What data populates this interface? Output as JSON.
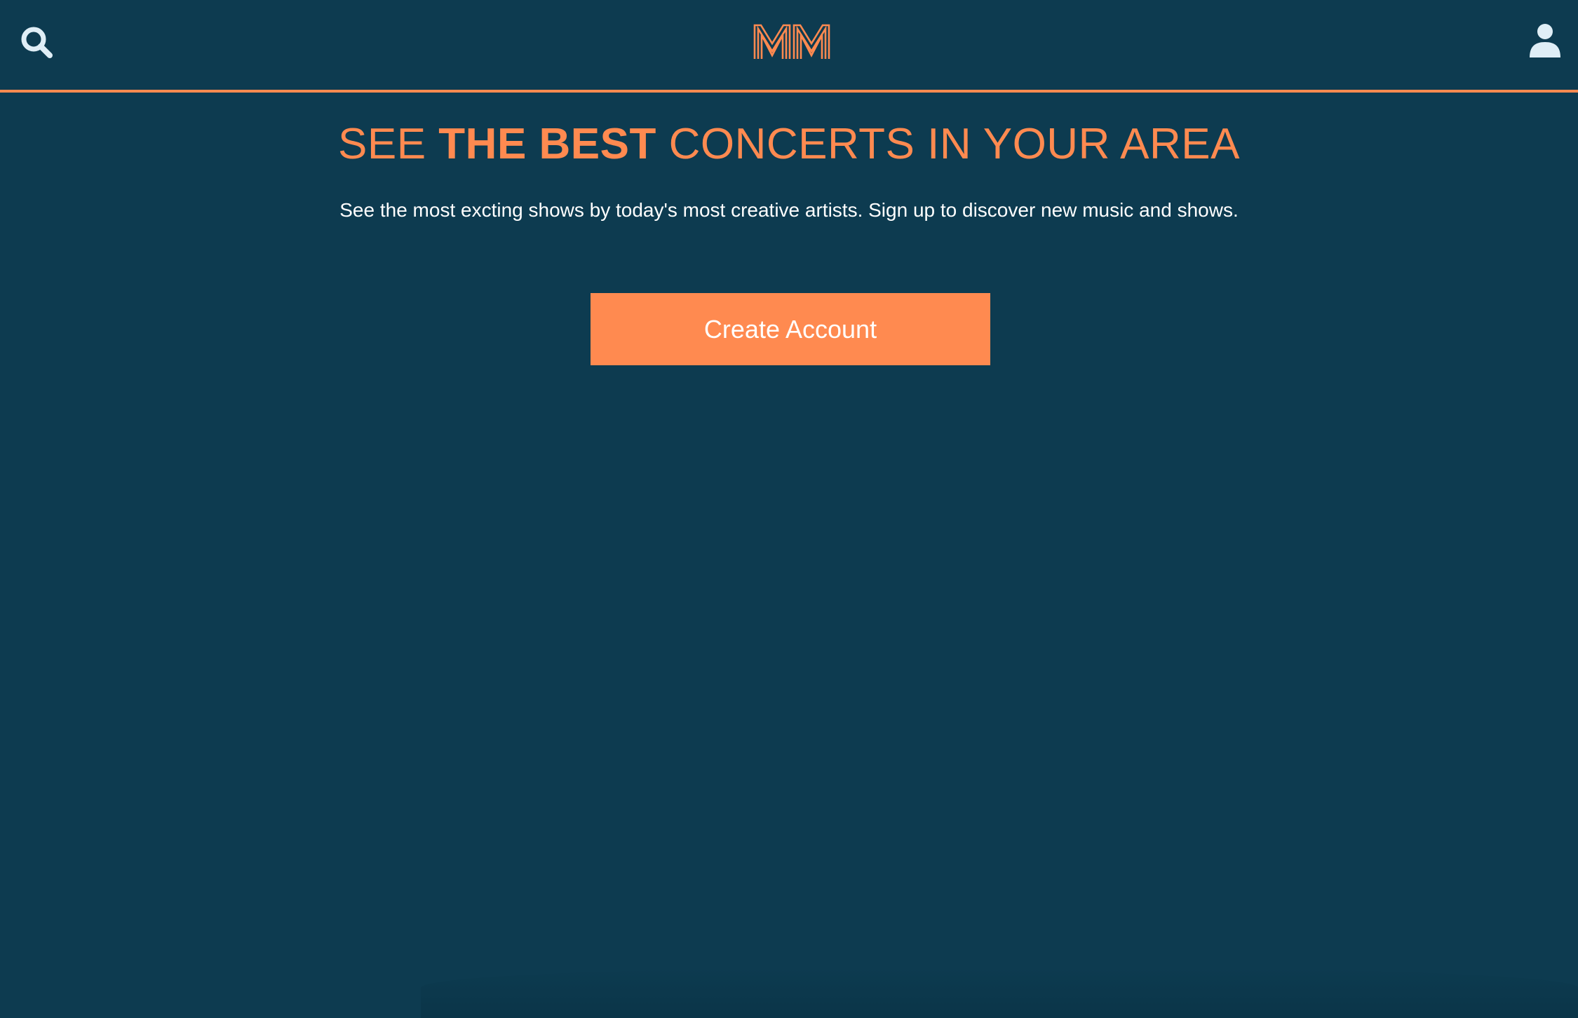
{
  "colors": {
    "background": "#0d3b50",
    "accent": "#ff8a50",
    "icon": "#dfeef6",
    "text": "#ffffff"
  },
  "header": {
    "search_icon": "search-icon",
    "logo_text": "MM",
    "user_icon": "user-icon"
  },
  "hero": {
    "title_pre": "SEE ",
    "title_strong": "THE BEST",
    "title_post": " CONCERTS IN YOUR AREA",
    "subtitle": "See the most excting shows by today's most creative artists. Sign up to discover new music and shows.",
    "cta_label": "Create Account"
  }
}
